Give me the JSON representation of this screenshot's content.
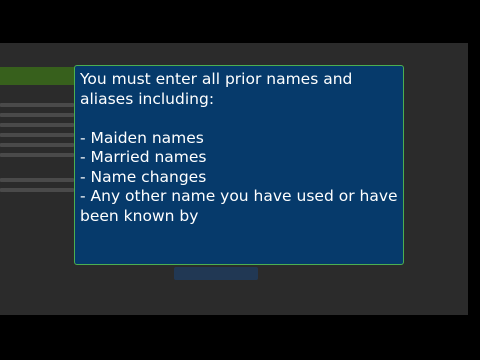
{
  "modal": {
    "intro": "You must enter all prior names and aliases including:",
    "items": [
      "- Maiden names",
      "- Married names",
      "- Name changes",
      "- Any other name you have used or have been known by"
    ]
  },
  "colors": {
    "modal_background": "#063a6b",
    "modal_border": "#4caf50",
    "page_dim": "#2b2b2b"
  }
}
